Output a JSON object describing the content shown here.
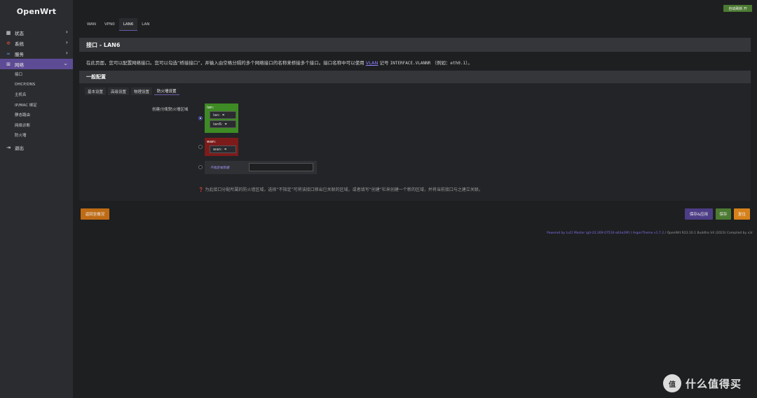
{
  "sidebar": {
    "logo": "OpenWrt",
    "items": [
      {
        "label": "状态",
        "icon": "dashboard-icon"
      },
      {
        "label": "系统",
        "icon": "gear-icon"
      },
      {
        "label": "服务",
        "icon": "link-icon"
      },
      {
        "label": "网络",
        "icon": "network-icon"
      }
    ],
    "network_sub": [
      "接口",
      "DHCP/DNS",
      "主机名",
      "IP/MAC 绑定",
      "静态路由",
      "网络诊断",
      "防火墙"
    ],
    "logout": "退出"
  },
  "topbar": {
    "auto_refresh": "自动刷新 开"
  },
  "tabs": [
    "WAN",
    "VPN0",
    "LAN6",
    "LAN"
  ],
  "active_tab": "LAN6",
  "page_title": "接口 - LAN6",
  "description": {
    "part1": "在此页面，您可以配置网络接口。您可以勾选“桥接接口”，并输入由空格分隔的多个网络接口的名称来桥接多个接口。接口名称中可以使用",
    "vlan": "VLAN",
    "part2": "记号",
    "mono": "INTERFACE.VLANNR",
    "part3": "（例如：",
    "example": "eth0.1",
    "part4": "）。"
  },
  "section": {
    "title": "一般配置",
    "subtabs": [
      "基本设置",
      "高级设置",
      "物理设置",
      "防火墙设置"
    ],
    "field_label": "创建/分配防火墙区域",
    "zones": {
      "lan": {
        "name": "lan:",
        "ifaces": [
          "lan:",
          "lan6:"
        ],
        "color": "#3e8a24"
      },
      "wan": {
        "name": "wan:",
        "ifaces": [
          "wan:"
        ],
        "color": "#7d1b1b"
      }
    },
    "unspecified": "不指定或新建:",
    "hint": "为此接口分配所属的防火墙区域，选择“不指定”可将该接口移出已关联的区域，或者填写“创建”栏来创建一个新的区域，并将当前接口与之建立关联。"
  },
  "buttons": {
    "back": "返回至概况",
    "save_apply": "保存&应用",
    "save": "保存",
    "reset": "复位"
  },
  "footer": {
    "luci": "Powered by LuCI Master (git-22.269.07510-a63e29f)",
    "sep1": " / ",
    "theme": "ArgonTheme v1.7.2",
    "rest": " / OpenWrt R23.10.1 Buddha V4 (2023) Compiled by x3r"
  },
  "watermark": {
    "badge": "值",
    "text": "什么值得买"
  }
}
